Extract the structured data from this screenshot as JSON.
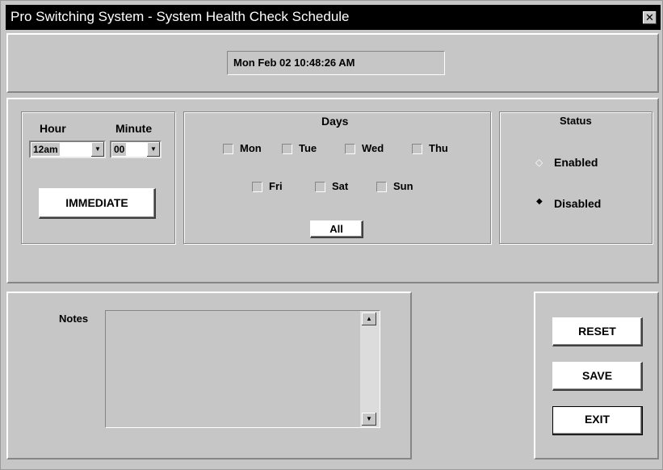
{
  "window": {
    "title": "Pro Switching System - System Health Check Schedule",
    "close_glyph": "✕"
  },
  "datetime": "Mon Feb 02 10:48:26 AM",
  "time": {
    "hour_label": "Hour",
    "minute_label": "Minute",
    "hour_value": "12am",
    "minute_value": "00",
    "immediate_label": "IMMEDIATE"
  },
  "days": {
    "label": "Days",
    "items": [
      {
        "label": "Mon",
        "checked": false
      },
      {
        "label": "Tue",
        "checked": false
      },
      {
        "label": "Wed",
        "checked": false
      },
      {
        "label": "Thu",
        "checked": false
      },
      {
        "label": "Fri",
        "checked": false
      },
      {
        "label": "Sat",
        "checked": false
      },
      {
        "label": "Sun",
        "checked": false
      }
    ],
    "all_label": "All"
  },
  "status": {
    "label": "Status",
    "options": [
      {
        "label": "Enabled",
        "selected": false
      },
      {
        "label": "Disabled",
        "selected": true
      }
    ]
  },
  "notes": {
    "label": "Notes",
    "value": ""
  },
  "icons": {
    "dropdown": "dropdown-arrow-icon",
    "scroll_up": "scroll-up-icon",
    "scroll_down": "scroll-down-icon"
  },
  "buttons": {
    "reset": "RESET",
    "save": "SAVE",
    "exit": "EXIT"
  }
}
